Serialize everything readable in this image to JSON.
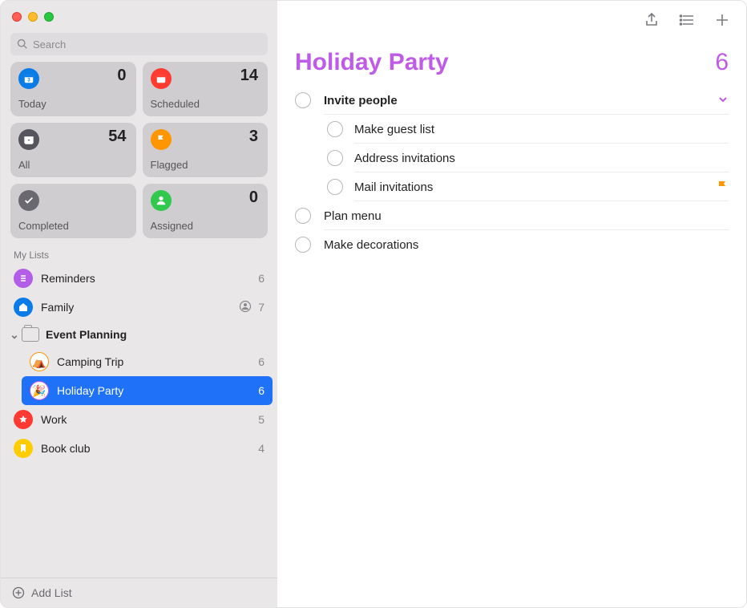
{
  "search": {
    "placeholder": "Search"
  },
  "smart": [
    {
      "key": "today",
      "label": "Today",
      "count": 0,
      "bg": "#0a7ce8",
      "icon": "calendar"
    },
    {
      "key": "scheduled",
      "label": "Scheduled",
      "count": 14,
      "bg": "#ff3a30",
      "icon": "calendar"
    },
    {
      "key": "all",
      "label": "All",
      "count": 54,
      "bg": "#56545c",
      "icon": "tray"
    },
    {
      "key": "flagged",
      "label": "Flagged",
      "count": 3,
      "bg": "#ff9500",
      "icon": "flag"
    },
    {
      "key": "completed",
      "label": "Completed",
      "count": "",
      "bg": "#6b6970",
      "icon": "check"
    },
    {
      "key": "assigned",
      "label": "Assigned",
      "count": 0,
      "bg": "#30c94d",
      "icon": "person"
    }
  ],
  "section_label": "My Lists",
  "lists": {
    "reminders": {
      "name": "Reminders",
      "count": 6,
      "color": "#b35ee8",
      "icon": "list"
    },
    "family": {
      "name": "Family",
      "count": 7,
      "color": "#0a7ce8",
      "icon": "house",
      "shared": true
    },
    "group": {
      "name": "Event Planning"
    },
    "camping": {
      "name": "Camping Trip",
      "count": 6,
      "color": "#ff9500",
      "emoji": "⛺️"
    },
    "holiday": {
      "name": "Holiday Party",
      "count": 6,
      "color": "#c05ae8",
      "emoji": "🎉",
      "selected": true
    },
    "work": {
      "name": "Work",
      "count": 5,
      "color": "#ff3a30",
      "icon": "star"
    },
    "book": {
      "name": "Book club",
      "count": 4,
      "color": "#ffcc00",
      "icon": "bookmark"
    }
  },
  "add_list_label": "Add List",
  "main": {
    "title": "Holiday Party",
    "count": 6,
    "items": {
      "invite": {
        "title": "Invite people",
        "parent": true
      },
      "guest": {
        "title": "Make guest list"
      },
      "address": {
        "title": "Address invitations"
      },
      "mail": {
        "title": "Mail invitations",
        "flagged": true
      },
      "menu": {
        "title": "Plan menu"
      },
      "deco": {
        "title": "Make decorations"
      }
    }
  }
}
